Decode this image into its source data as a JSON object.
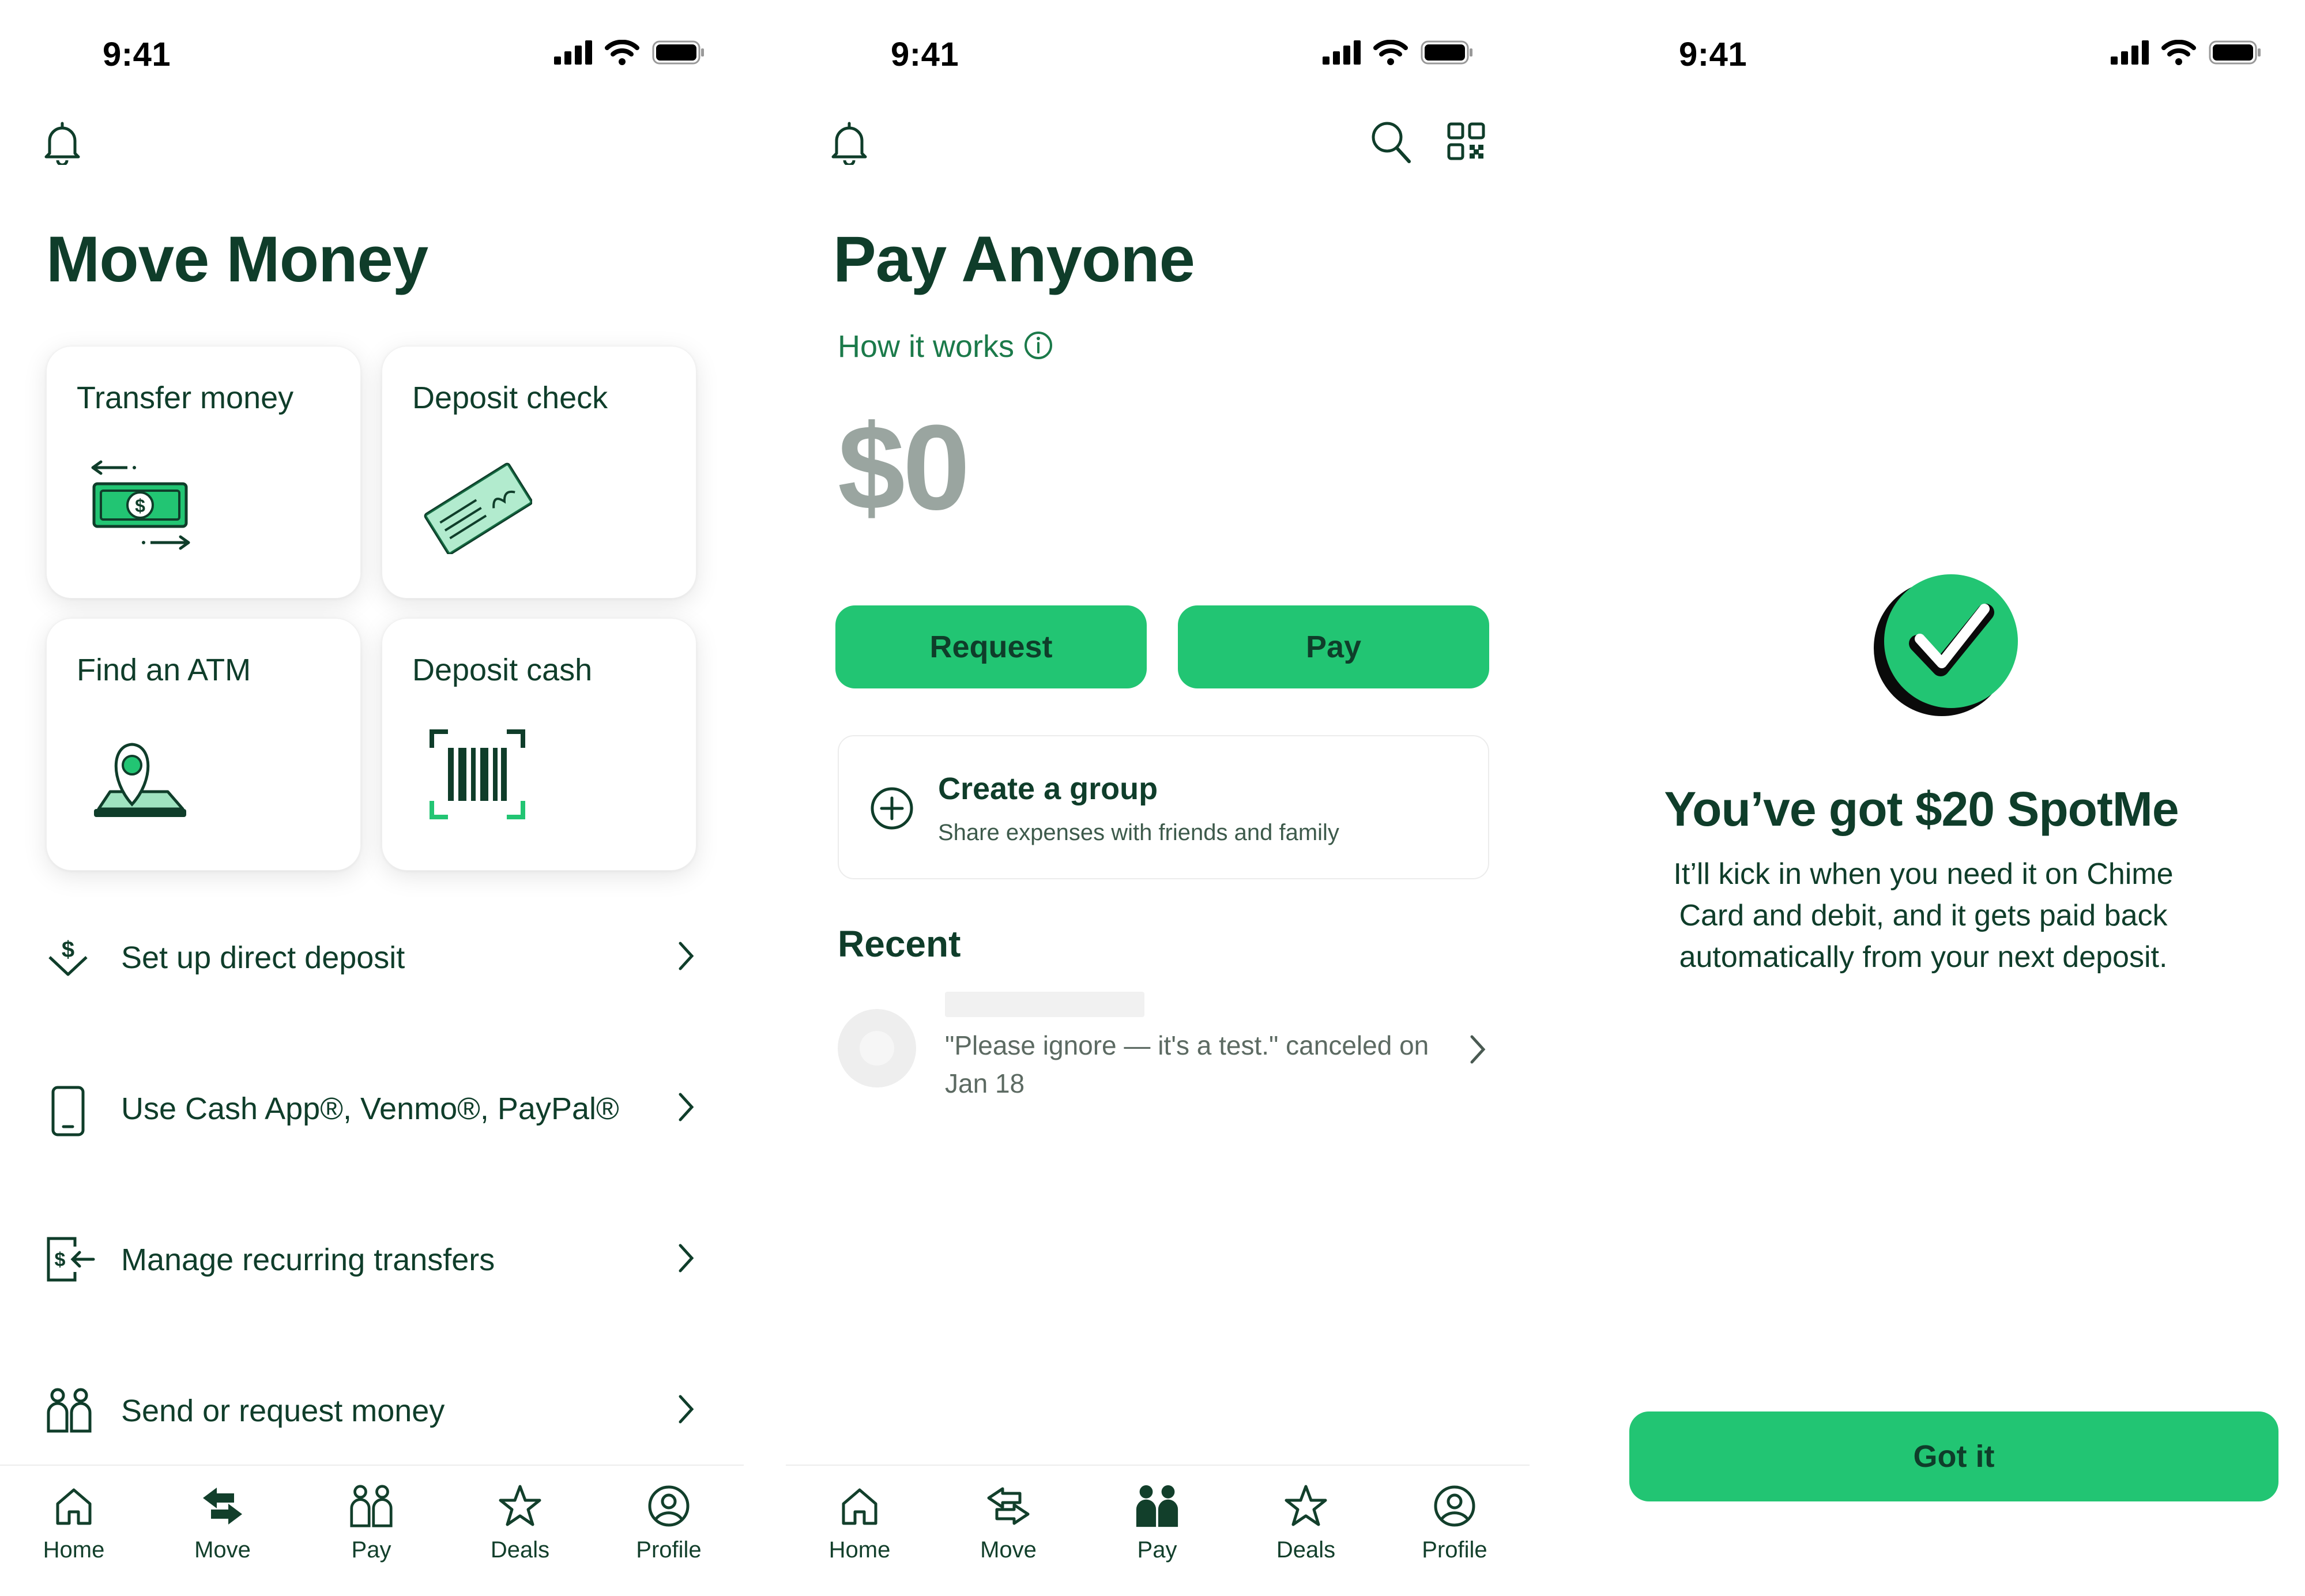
{
  "status_bar": {
    "time": "9:41"
  },
  "colors": {
    "brand_green": "#22c573",
    "dark_green": "#0f3d2a",
    "accent_text": "#1b7a4a",
    "muted_amount": "#9aa5a0"
  },
  "move_money": {
    "title": "Move Money",
    "tiles": [
      {
        "label": "Transfer money",
        "icon": "cash-transfer-illustration"
      },
      {
        "label": "Deposit check",
        "icon": "check-illustration"
      },
      {
        "label": "Find an ATM",
        "icon": "atm-map-pin-illustration"
      },
      {
        "label": "Deposit cash",
        "icon": "barcode-scan-illustration"
      }
    ],
    "list": [
      {
        "label": "Set up direct deposit",
        "icon": "direct-deposit-icon"
      },
      {
        "label": "Use Cash App®, Venmo®, PayPal®",
        "icon": "phone-icon"
      },
      {
        "label": "Manage recurring transfers",
        "icon": "recurring-transfer-icon"
      },
      {
        "label": "Send or request money",
        "icon": "people-icon"
      }
    ]
  },
  "pay_anyone": {
    "title": "Pay Anyone",
    "how_it_works": "How it works",
    "amount": "$0",
    "request_label": "Request",
    "pay_label": "Pay",
    "group": {
      "title": "Create a group",
      "subtitle": "Share expenses with friends and family"
    },
    "recent_title": "Recent",
    "recent": [
      {
        "text": "\"Please ignore — it's a test.\" canceled on Jan 18"
      }
    ]
  },
  "spotme": {
    "title": "You’ve got $20 SpotMe",
    "body": "It’ll kick in when you need it on Chime Card and debit, and it gets paid back automatically from your next deposit.",
    "button_label": "Got it"
  },
  "tabs": [
    {
      "label": "Home",
      "icon": "home-icon"
    },
    {
      "label": "Move",
      "icon": "move-icon"
    },
    {
      "label": "Pay",
      "icon": "pay-icon"
    },
    {
      "label": "Deals",
      "icon": "star-icon"
    },
    {
      "label": "Profile",
      "icon": "profile-icon"
    }
  ]
}
